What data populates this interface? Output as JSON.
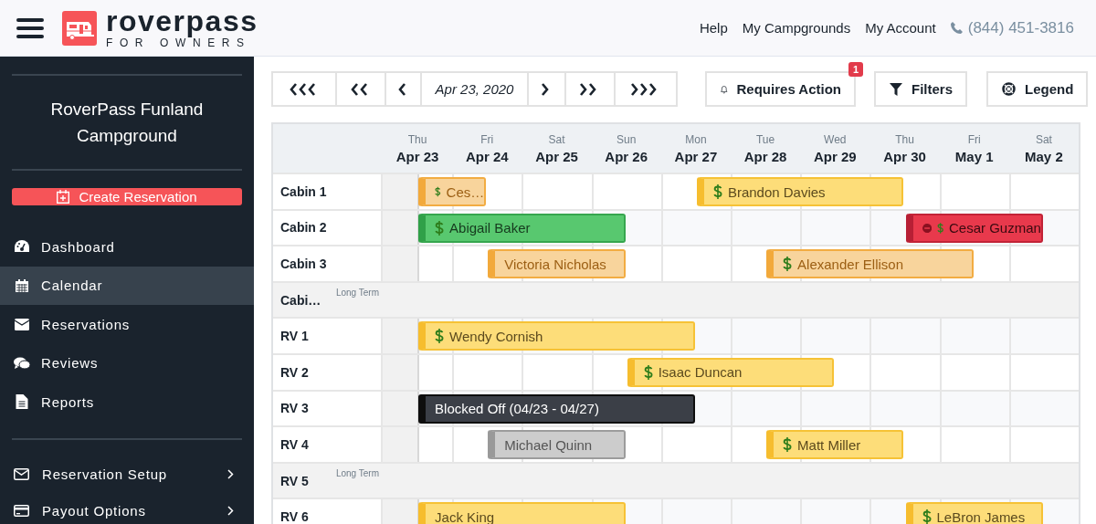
{
  "header": {
    "brand": "roverpass",
    "tagline": "FOR OWNERS",
    "links": [
      {
        "label": "Help"
      },
      {
        "label": "My Campgrounds"
      },
      {
        "label": "My Account"
      }
    ],
    "phone": "(844) 451-3816"
  },
  "sidebar": {
    "campground": "RoverPass Funland Campground",
    "create_button": "Create Reservation",
    "items": [
      {
        "label": "Dashboard",
        "selected": false
      },
      {
        "label": "Calendar",
        "selected": true
      },
      {
        "label": "Reservations",
        "selected": false
      },
      {
        "label": "Reviews",
        "selected": false
      },
      {
        "label": "Reports",
        "selected": false
      }
    ],
    "setup_items": [
      {
        "label": "Reservation Setup"
      },
      {
        "label": "Payout Options"
      }
    ]
  },
  "toolbar": {
    "date": "Apr 23, 2020",
    "requires_action": {
      "label": "Requires Action",
      "count": "1"
    },
    "filters": "Filters",
    "legend": "Legend"
  },
  "calendar": {
    "days": [
      {
        "weekday": "Thu",
        "date": "Apr 23"
      },
      {
        "weekday": "Fri",
        "date": "Apr 24"
      },
      {
        "weekday": "Sat",
        "date": "Apr 25"
      },
      {
        "weekday": "Sun",
        "date": "Apr 26"
      },
      {
        "weekday": "Mon",
        "date": "Apr 27"
      },
      {
        "weekday": "Tue",
        "date": "Apr 28"
      },
      {
        "weekday": "Wed",
        "date": "Apr 29"
      },
      {
        "weekday": "Thu",
        "date": "Apr 30"
      },
      {
        "weekday": "Fri",
        "date": "May 1"
      },
      {
        "weekday": "Sat",
        "date": "May 2"
      }
    ],
    "rows": [
      {
        "name": "Cabin 1",
        "kind": "site",
        "bookings": [
          {
            "guest": "Ces…",
            "kind": "unpaid",
            "balance_due": true,
            "flagged": false
          },
          {
            "guest": "Brandon Davies",
            "kind": "reserved",
            "balance_due": true,
            "flagged": false
          }
        ]
      },
      {
        "name": "Cabin 2",
        "kind": "site",
        "bookings": [
          {
            "guest": "Abigail Baker",
            "kind": "checked_in",
            "balance_due": true,
            "flagged": false
          },
          {
            "guest": "Cesar Guzman",
            "kind": "alert",
            "balance_due": true,
            "flagged": true
          }
        ]
      },
      {
        "name": "Cabin 3",
        "kind": "site",
        "bookings": [
          {
            "guest": "Victoria Nicholas",
            "kind": "unpaid",
            "balance_due": false,
            "flagged": false
          },
          {
            "guest": "Alexander Ellison",
            "kind": "unpaid",
            "balance_due": true,
            "flagged": false
          }
        ]
      },
      {
        "name": "Cabi…",
        "kind": "long_term",
        "tag": "Long Term"
      },
      {
        "name": "RV 1",
        "kind": "site",
        "bookings": [
          {
            "guest": "Wendy Cornish",
            "kind": "reserved",
            "balance_due": true,
            "flagged": false
          }
        ]
      },
      {
        "name": "RV 2",
        "kind": "site",
        "bookings": [
          {
            "guest": "Isaac Duncan",
            "kind": "reserved",
            "balance_due": true,
            "flagged": false
          }
        ]
      },
      {
        "name": "RV 3",
        "kind": "site",
        "bookings": [
          {
            "guest": "Blocked Off (04/23 - 04/27)",
            "kind": "blocked",
            "balance_due": false,
            "flagged": false
          }
        ]
      },
      {
        "name": "RV 4",
        "kind": "site",
        "bookings": [
          {
            "guest": "Michael Quinn",
            "kind": "checked_out",
            "balance_due": false,
            "flagged": false
          },
          {
            "guest": "Matt Miller",
            "kind": "reserved",
            "balance_due": true,
            "flagged": false
          }
        ]
      },
      {
        "name": "RV 5",
        "kind": "long_term",
        "tag": "Long Term"
      },
      {
        "name": "RV 6",
        "kind": "site",
        "bookings": [
          {
            "guest": "Jack King",
            "kind": "reserved",
            "balance_due": false,
            "flagged": false
          },
          {
            "guest": "LeBron James",
            "kind": "reserved",
            "balance_due": true,
            "flagged": false
          }
        ]
      }
    ]
  }
}
